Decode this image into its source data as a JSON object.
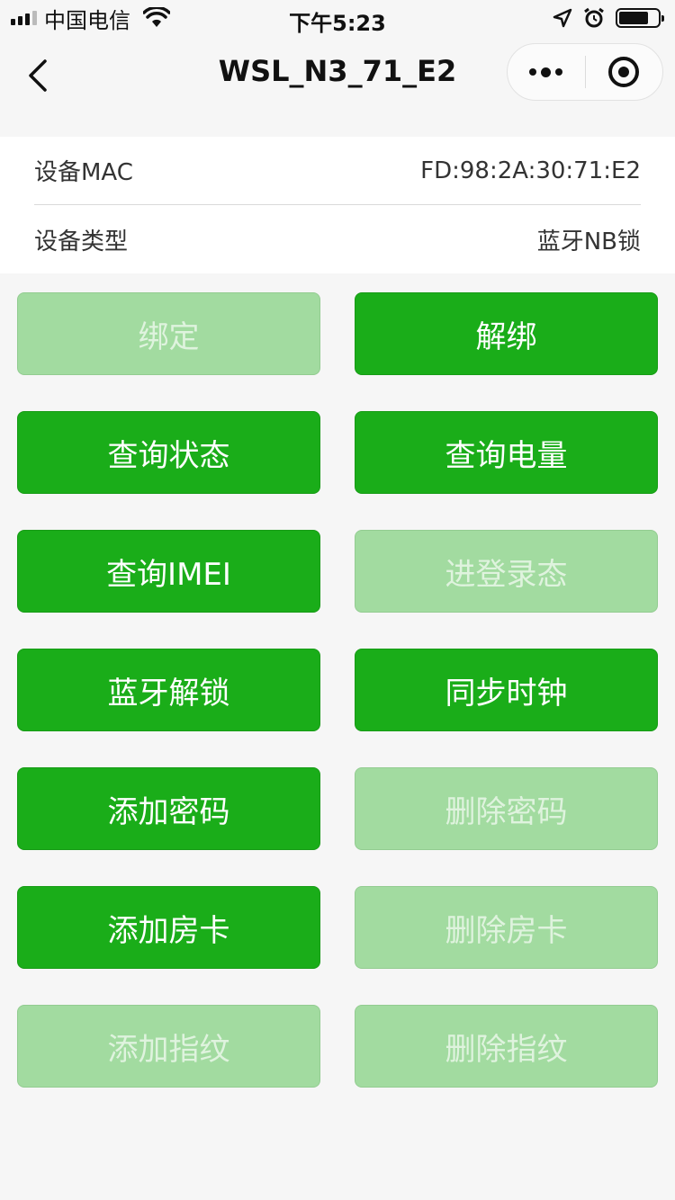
{
  "status_bar": {
    "carrier": "中国电信",
    "time": "下午5:23",
    "battery_level": 0.75,
    "icons": [
      "signal-icon",
      "wifi-icon",
      "location-icon",
      "alarm-icon",
      "battery-icon"
    ]
  },
  "nav": {
    "title": "WSL_N3_71_E2",
    "back_icon": "chevron-left-icon",
    "more_icon": "more-dots-icon",
    "close_icon": "target-circle-icon"
  },
  "device_info": {
    "mac_label": "设备MAC",
    "mac_value": "FD:98:2A:30:71:E2",
    "type_label": "设备类型",
    "type_value": "蓝牙NB锁"
  },
  "colors": {
    "primary": "#1aad19",
    "disabled": "#a2dba0",
    "background": "#f6f6f6"
  },
  "buttons": [
    {
      "label": "绑定",
      "enabled": false
    },
    {
      "label": "解绑",
      "enabled": true
    },
    {
      "label": "查询状态",
      "enabled": true
    },
    {
      "label": "查询电量",
      "enabled": true
    },
    {
      "label": "查询IMEI",
      "enabled": true
    },
    {
      "label": "进登录态",
      "enabled": false
    },
    {
      "label": "蓝牙解锁",
      "enabled": true
    },
    {
      "label": "同步时钟",
      "enabled": true
    },
    {
      "label": "添加密码",
      "enabled": true
    },
    {
      "label": "删除密码",
      "enabled": false
    },
    {
      "label": "添加房卡",
      "enabled": true
    },
    {
      "label": "删除房卡",
      "enabled": false
    },
    {
      "label": "添加指纹",
      "enabled": false
    },
    {
      "label": "删除指纹",
      "enabled": false
    }
  ]
}
